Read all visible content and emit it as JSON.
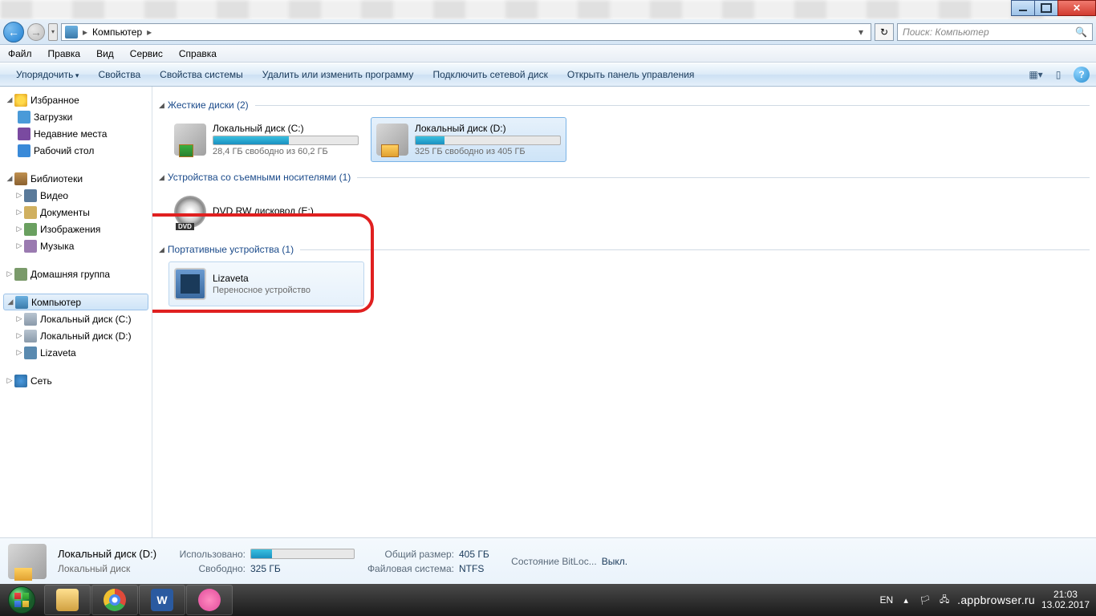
{
  "titlebar": {
    "blurred": true
  },
  "nav": {
    "breadcrumb": [
      "Компьютер"
    ],
    "search_placeholder": "Поиск: Компьютер"
  },
  "menu": [
    "Файл",
    "Правка",
    "Вид",
    "Сервис",
    "Справка"
  ],
  "toolbar": {
    "items": [
      "Упорядочить",
      "Свойства",
      "Свойства системы",
      "Удалить или изменить программу",
      "Подключить сетевой диск",
      "Открыть панель управления"
    ]
  },
  "sidebar": {
    "favorites": {
      "label": "Избранное",
      "items": [
        "Загрузки",
        "Недавние места",
        "Рабочий стол"
      ]
    },
    "libraries": {
      "label": "Библиотеки",
      "items": [
        "Видео",
        "Документы",
        "Изображения",
        "Музыка"
      ]
    },
    "homegroup": {
      "label": "Домашняя группа"
    },
    "computer": {
      "label": "Компьютер",
      "drives": [
        "Локальный диск (C:)",
        "Локальный диск (D:)",
        "Lizaveta"
      ]
    },
    "network": {
      "label": "Сеть"
    }
  },
  "groups": {
    "hdd": {
      "title": "Жесткие диски",
      "count": "(2)",
      "drives": [
        {
          "name": "Локальный диск (C:)",
          "free": "28,4 ГБ свободно из 60,2 ГБ",
          "fill": 52
        },
        {
          "name": "Локальный диск (D:)",
          "free": "325 ГБ свободно из 405 ГБ",
          "fill": 20,
          "selected": true
        }
      ]
    },
    "removable": {
      "title": "Устройства со съемными носителями",
      "count": "(1)",
      "drives": [
        {
          "name": "DVD RW дисковод (E:)"
        }
      ]
    },
    "portable": {
      "title": "Портативные устройства",
      "count": "(1)",
      "drives": [
        {
          "name": "Lizaveta",
          "sub": "Переносное устройство",
          "hover": true
        }
      ]
    }
  },
  "details": {
    "name": "Локальный диск (D:)",
    "type": "Локальный диск",
    "used_label": "Использовано:",
    "free_label": "Свободно:",
    "free_val": "325 ГБ",
    "total_label": "Общий размер:",
    "total_val": "405 ГБ",
    "fs_label": "Файловая система:",
    "fs_val": "NTFS",
    "bl_label": "Состояние BitLoc...",
    "bl_val": "Выкл.",
    "fill": 20
  },
  "taskbar": {
    "lang": "EN",
    "watermark": ".appbrowser.ru",
    "time": "21:03",
    "date": "13.02.2017"
  }
}
